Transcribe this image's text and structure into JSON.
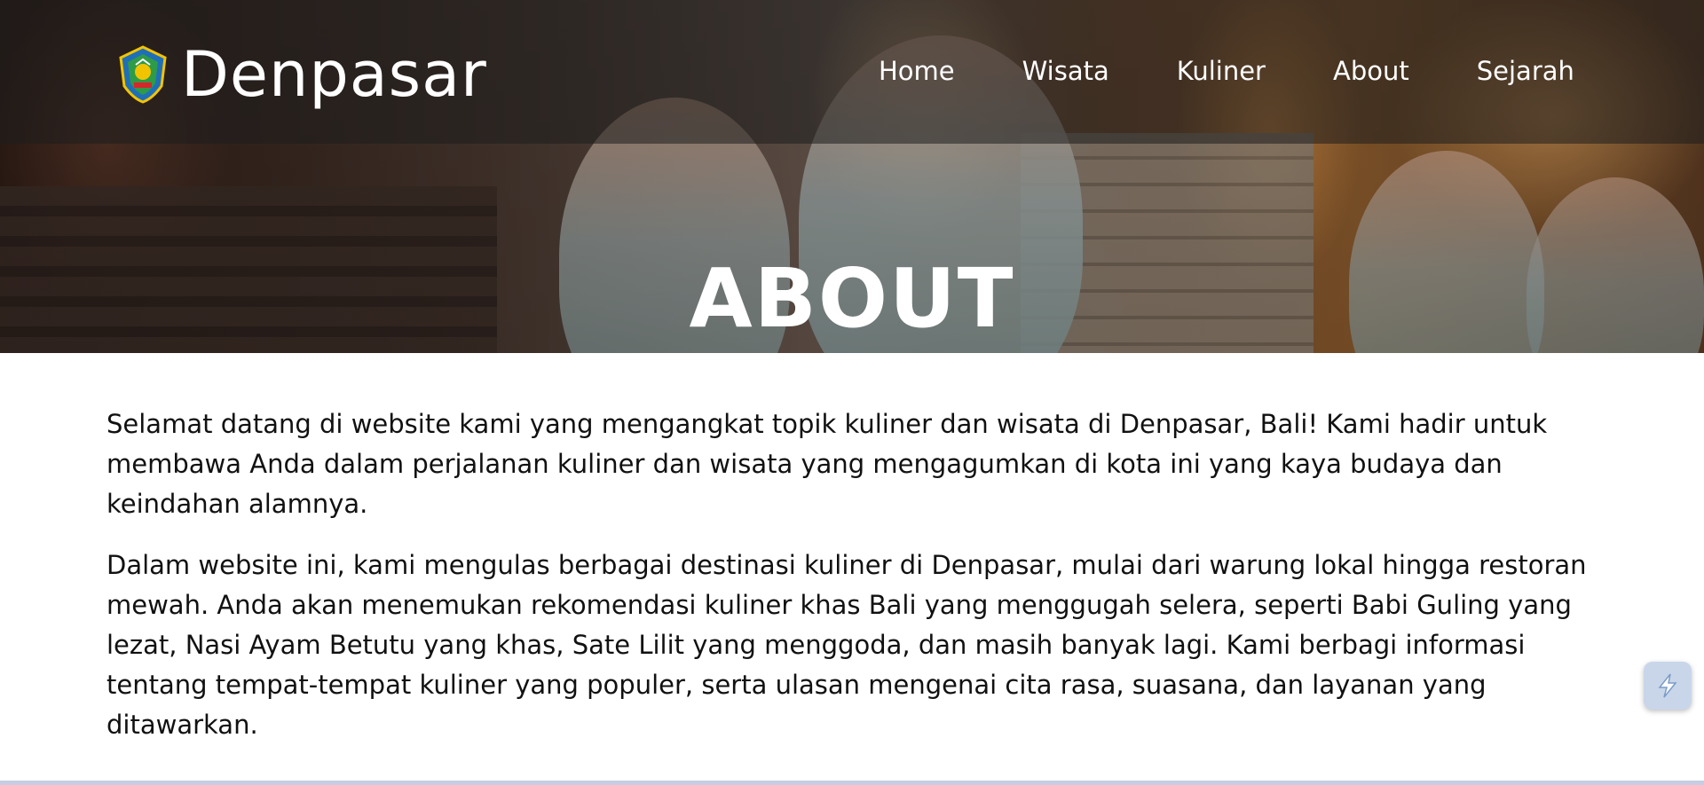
{
  "brand": {
    "name": "Denpasar",
    "logo": "denpasar-crest-icon"
  },
  "nav": {
    "items": [
      {
        "label": "Home"
      },
      {
        "label": "Wisata"
      },
      {
        "label": "Kuliner"
      },
      {
        "label": "About"
      },
      {
        "label": "Sejarah"
      }
    ]
  },
  "hero": {
    "title": "ABOUT"
  },
  "content": {
    "paragraphs": [
      "Selamat datang di website kami yang mengangkat topik kuliner dan wisata di Denpasar, Bali! Kami hadir untuk membawa Anda dalam perjalanan kuliner dan wisata yang mengagumkan di kota ini yang kaya budaya dan keindahan alamnya.",
      "Dalam website ini, kami mengulas berbagai destinasi kuliner di Denpasar, mulai dari warung lokal hingga restoran mewah. Anda akan menemukan rekomendasi kuliner khas Bali yang menggugah selera, seperti Babi Guling yang lezat, Nasi Ayam Betutu yang khas, Sate Lilit yang menggoda, dan masih banyak lagi. Kami berbagi informasi tentang tempat-tempat kuliner yang populer, serta ulasan mengenai cita rasa, suasana, dan layanan yang ditawarkan."
    ]
  },
  "floating_button": {
    "icon": "lightning-icon"
  },
  "colors": {
    "nav_bg": "#1e1e1e",
    "text": "#111111",
    "fab_bg": "#c9d6ea"
  }
}
